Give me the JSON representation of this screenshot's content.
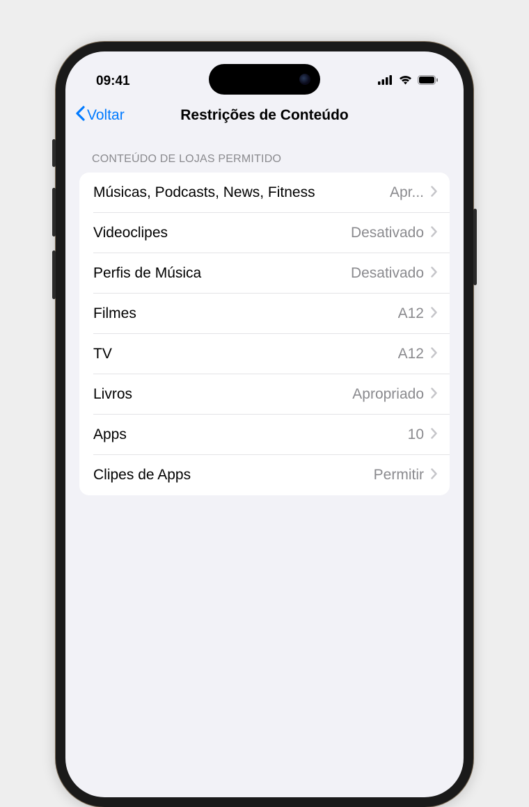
{
  "status_bar": {
    "time": "09:41"
  },
  "nav": {
    "back_label": "Voltar",
    "title": "Restrições de Conteúdo"
  },
  "section": {
    "header": "CONTEÚDO DE LOJAS PERMITIDO",
    "rows": [
      {
        "label": "Músicas, Podcasts, News, Fitness",
        "value": "Apr...",
        "truncated": true
      },
      {
        "label": "Videoclipes",
        "value": "Desativado"
      },
      {
        "label": "Perfis de Música",
        "value": "Desativado"
      },
      {
        "label": "Filmes",
        "value": "A12"
      },
      {
        "label": "TV",
        "value": "A12"
      },
      {
        "label": "Livros",
        "value": "Apropriado"
      },
      {
        "label": "Apps",
        "value": "10"
      },
      {
        "label": "Clipes de Apps",
        "value": "Permitir"
      }
    ]
  }
}
